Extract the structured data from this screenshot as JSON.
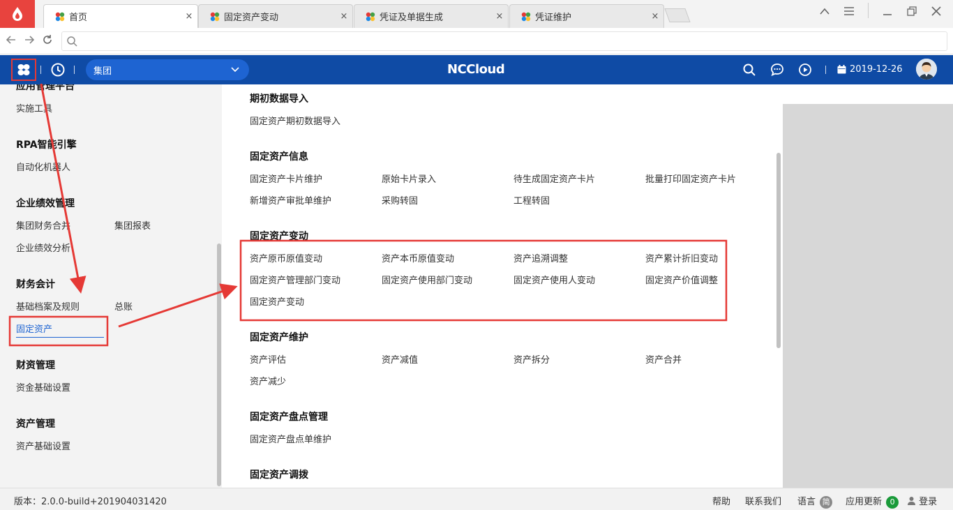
{
  "browser": {
    "tabs": [
      {
        "label": "首页",
        "close": "×"
      },
      {
        "label": "固定资产变动",
        "close": "×"
      },
      {
        "label": "凭证及单据生成",
        "close": "×"
      },
      {
        "label": "凭证维护",
        "close": "×"
      }
    ],
    "address": {
      "value": ""
    }
  },
  "header": {
    "org_selector": "集团",
    "brand": "NCCloud",
    "date": "2019-12-26"
  },
  "sidebar": {
    "partial_title": "应用管理平台",
    "sections": [
      {
        "title": "",
        "items": [
          "实施工具"
        ]
      },
      {
        "title": "RPA智能引擎",
        "items": [
          "自动化机器人"
        ]
      },
      {
        "title": "企业绩效管理",
        "items": [
          "集团财务合并",
          "集团报表",
          "企业绩效分析"
        ]
      },
      {
        "title": "财务会计",
        "items": [
          "基础档案及规则",
          "总账",
          "固定资产"
        ]
      },
      {
        "title": "财资管理",
        "items": [
          "资金基础设置"
        ]
      },
      {
        "title": "资产管理",
        "items": [
          "资产基础设置"
        ]
      }
    ]
  },
  "menu": {
    "groups": [
      {
        "title": "期初数据导入",
        "items": [
          "固定资产期初数据导入"
        ]
      },
      {
        "title": "固定资产信息",
        "items": [
          "固定资产卡片维护",
          "原始卡片录入",
          "待生成固定资产卡片",
          "批量打印固定资产卡片",
          "新增资产审批单维护",
          "采购转固",
          "工程转固"
        ]
      },
      {
        "title": "固定资产变动",
        "items": [
          "资产原币原值变动",
          "资产本币原值变动",
          "资产追溯调整",
          "资产累计折旧变动",
          "固定资产管理部门变动",
          "固定资产使用部门变动",
          "固定资产使用人变动",
          "固定资产价值调整",
          "固定资产变动"
        ]
      },
      {
        "title": "固定资产维护",
        "items": [
          "资产评估",
          "资产减值",
          "资产拆分",
          "资产合并",
          "资产减少"
        ]
      },
      {
        "title": "固定资产盘点管理",
        "items": [
          "固定资产盘点单维护"
        ]
      },
      {
        "title": "固定资产调拨",
        "items": []
      }
    ]
  },
  "footer": {
    "version": "版本：2.0.0-build+201904031420",
    "help": "帮助",
    "contact": "联系我们",
    "language": "语言",
    "language_badge": "简",
    "updates": "应用更新",
    "updates_count": "0",
    "login": "登录"
  },
  "colors": {
    "header_bg": "#0f4ba5",
    "org_select_bg": "#1e64d2",
    "active_link": "#1e64d2",
    "annotation": "#e53935"
  }
}
